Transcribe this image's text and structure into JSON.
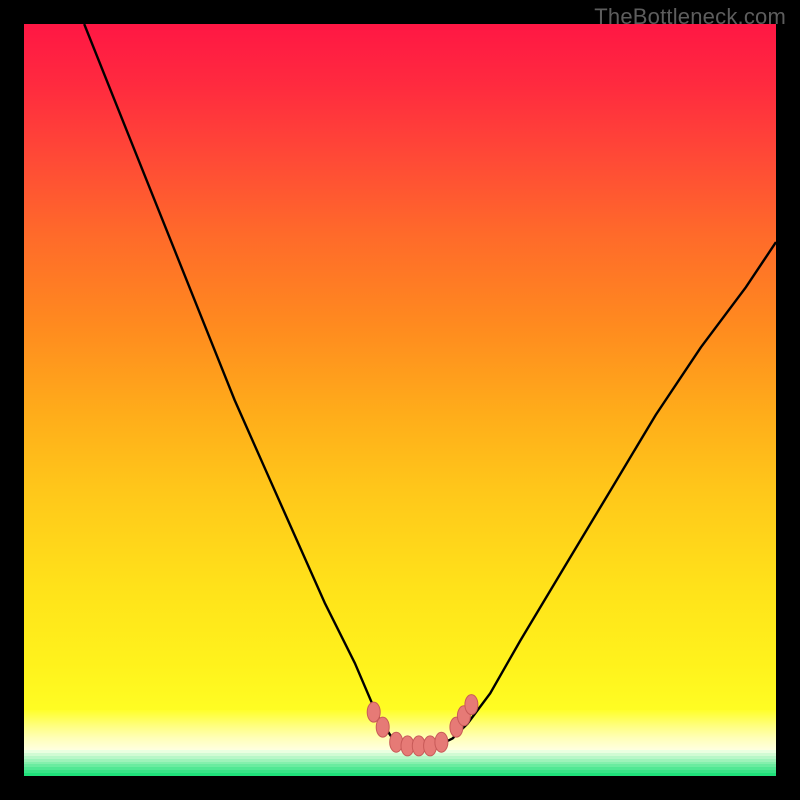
{
  "watermark": "TheBottleneck.com",
  "colors": {
    "page_bg": "#000000",
    "curve": "#000000",
    "marker_fill": "#e67a76",
    "marker_stroke": "#c85a58",
    "gradient_top": "#ff1744",
    "gradient_bottom": "#ffff2a",
    "green_start": "#eaffe0",
    "green_end": "#1fe07a"
  },
  "chart_data": {
    "type": "line",
    "title": "",
    "xlabel": "",
    "ylabel": "",
    "xlim": [
      0,
      100
    ],
    "ylim": [
      0,
      100
    ],
    "grid": false,
    "legend": false,
    "notes": "V-shaped bottleneck curve over heatmap-style gradient. Lower y = better (green). Markers cluster at minimum.",
    "series": [
      {
        "name": "bottleneck-curve",
        "x": [
          8,
          12,
          16,
          20,
          24,
          28,
          32,
          36,
          40,
          44,
          47,
          49,
          51,
          53,
          55,
          57,
          59,
          62,
          66,
          72,
          78,
          84,
          90,
          96,
          100
        ],
        "y": [
          100,
          90,
          80,
          70,
          60,
          50,
          41,
          32,
          23,
          15,
          8,
          5,
          4,
          4,
          4,
          5,
          7,
          11,
          18,
          28,
          38,
          48,
          57,
          65,
          71
        ]
      }
    ],
    "markers": {
      "name": "highlighted-points",
      "x": [
        46.5,
        47.7,
        49.5,
        51.0,
        52.5,
        54.0,
        55.5,
        57.5,
        58.5,
        59.5
      ],
      "y": [
        8.5,
        6.5,
        4.5,
        4.0,
        4.0,
        4.0,
        4.5,
        6.5,
        8.0,
        9.5
      ]
    },
    "green_band_fraction": 0.035
  }
}
